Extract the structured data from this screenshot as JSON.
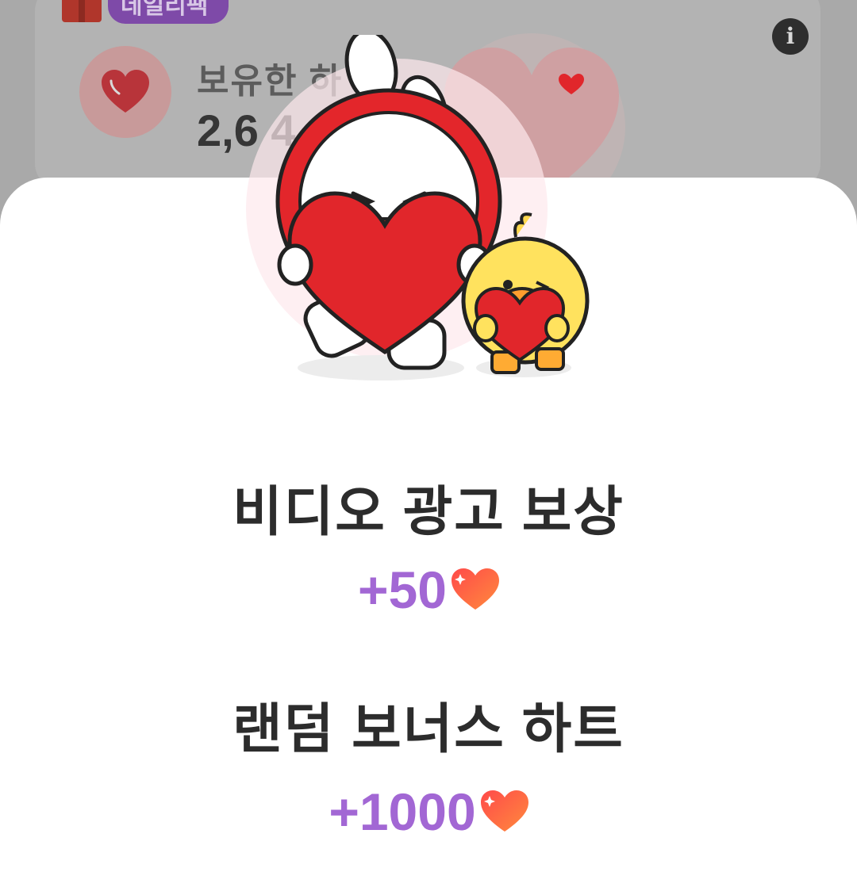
{
  "background": {
    "badge_label": "데일리팩",
    "owned_label": "보유한 하",
    "owned_count": "2,6 4"
  },
  "sheet": {
    "rewards": [
      {
        "title": "비디오 광고 보상",
        "amount": "+50"
      },
      {
        "title": "랜덤 보너스 하트",
        "amount": "+1000"
      }
    ]
  },
  "colors": {
    "accent_purple": "#a267d4",
    "heart_red": "#e6373f",
    "heart_orange": "#ff7a45"
  },
  "icons": [
    "gift-icon",
    "info-icon",
    "heart-icon",
    "mascot-illustration"
  ]
}
